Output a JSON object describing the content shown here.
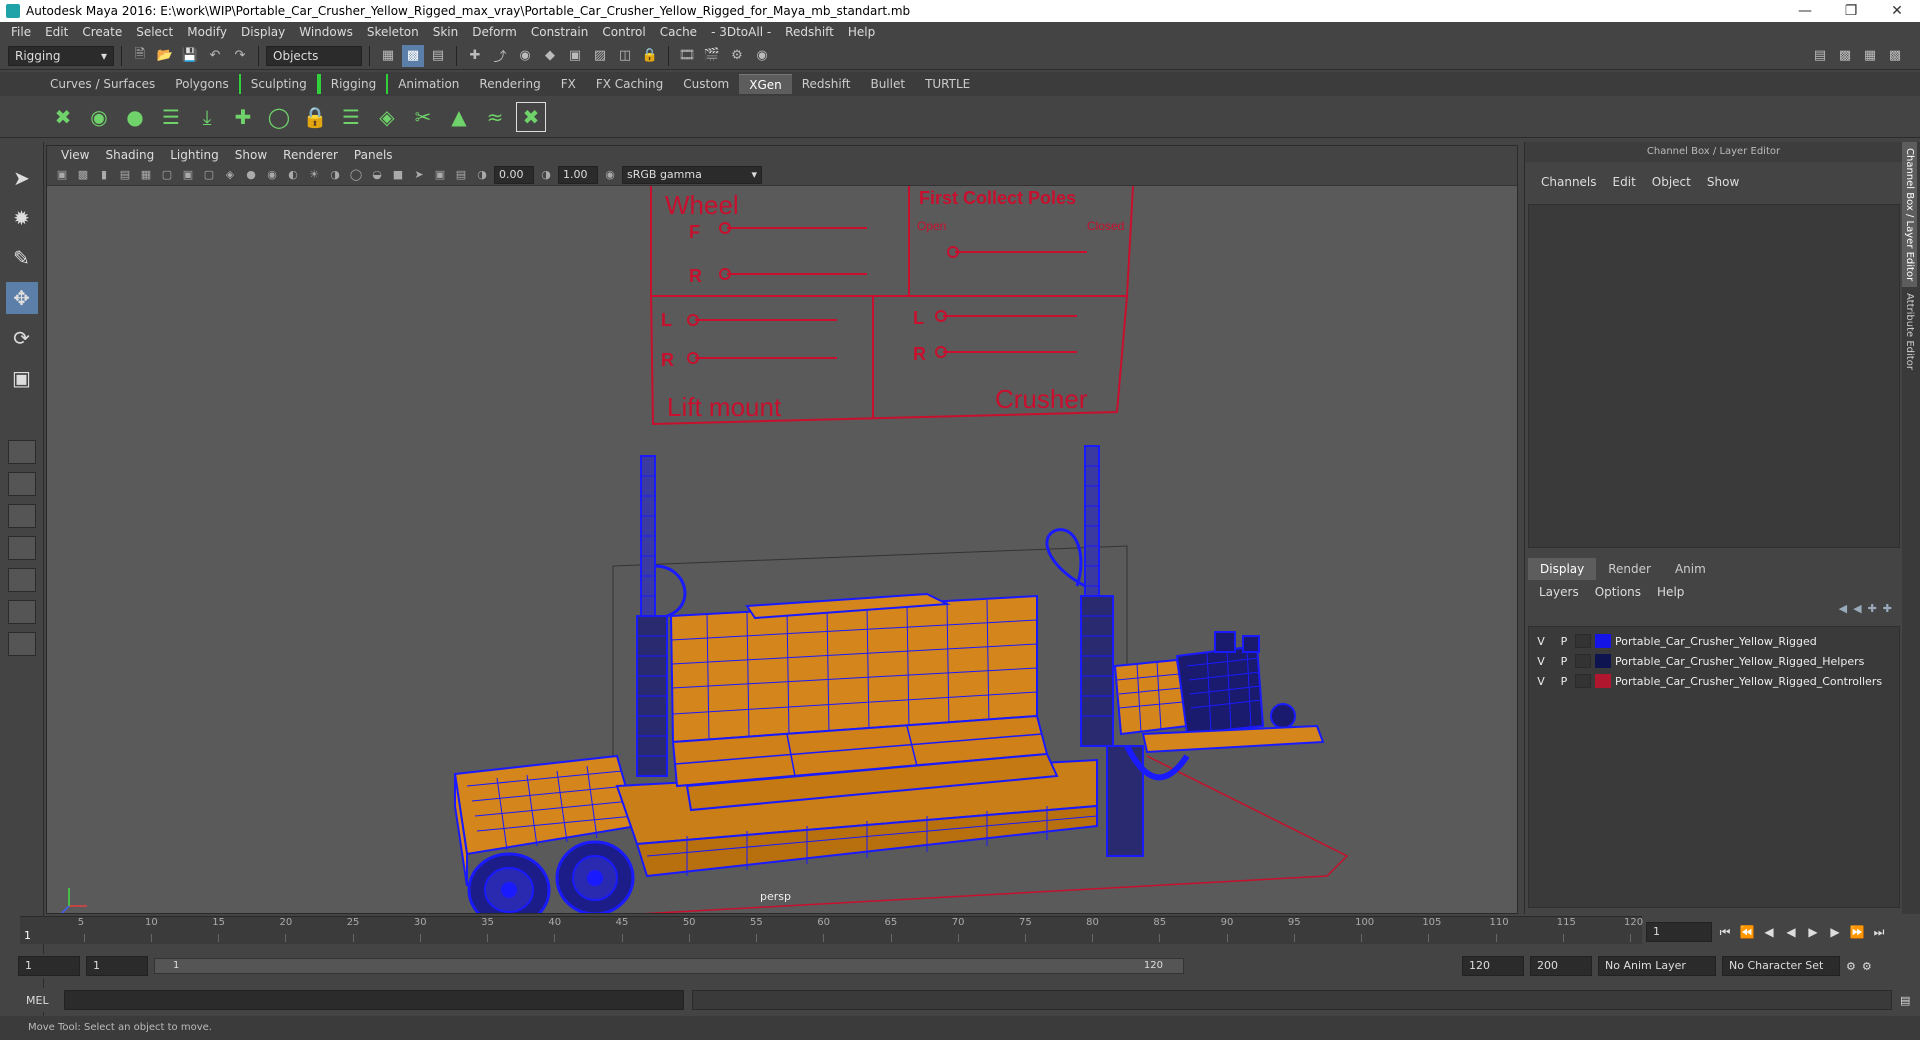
{
  "window": {
    "title": "Autodesk Maya 2016: E:\\work\\WIP\\Portable_Car_Crusher_Yellow_Rigged_max_vray\\Portable_Car_Crusher_Yellow_Rigged_for_Maya_mb_standart.mb"
  },
  "menubar": [
    "File",
    "Edit",
    "Create",
    "Select",
    "Modify",
    "Display",
    "Windows",
    "Skeleton",
    "Skin",
    "Deform",
    "Constrain",
    "Control",
    "Cache",
    "- 3DtoAll -",
    "Redshift",
    "Help"
  ],
  "statusline": {
    "mode": "Rigging",
    "selection_mode": "Objects"
  },
  "shelf_tabs": [
    "Curves / Surfaces",
    "Polygons",
    "Sculpting",
    "Rigging",
    "Animation",
    "Rendering",
    "FX",
    "FX Caching",
    "Custom",
    "XGen",
    "Redshift",
    "Bullet",
    "TURTLE"
  ],
  "shelf_tabs_active": "XGen",
  "viewport": {
    "menu": [
      "View",
      "Shading",
      "Lighting",
      "Show",
      "Renderer",
      "Panels"
    ],
    "exposure": "0.00",
    "gamma_value": "1.00",
    "color_space": "sRGB gamma",
    "camera": "persp",
    "controls": {
      "wheel_title": "Wheel",
      "wheel_f": "F",
      "wheel_r": "R",
      "poles_title": "First Collect Poles",
      "poles_open": "Open",
      "poles_closed": "Closed",
      "lift_l": "L",
      "lift_r": "R",
      "lift_title": "Lift mount",
      "crusher_l": "L",
      "crusher_r": "R",
      "crusher_title": "Crusher"
    }
  },
  "channel_box": {
    "title": "Channel Box / Layer Editor",
    "menu": [
      "Channels",
      "Edit",
      "Object",
      "Show"
    ]
  },
  "layer_editor": {
    "tabs": [
      "Display",
      "Render",
      "Anim"
    ],
    "active_tab": "Display",
    "menu": [
      "Layers",
      "Options",
      "Help"
    ],
    "layers": [
      {
        "v": "V",
        "p": "P",
        "color": "#1414e6",
        "name": "Portable_Car_Crusher_Yellow_Rigged"
      },
      {
        "v": "V",
        "p": "P",
        "color": "#0d1450",
        "name": "Portable_Car_Crusher_Yellow_Rigged_Helpers"
      },
      {
        "v": "V",
        "p": "P",
        "color": "#b0162e",
        "name": "Portable_Car_Crusher_Yellow_Rigged_Controllers"
      }
    ]
  },
  "side_tabs": [
    "Channel Box / Layer Editor",
    "Attribute Editor"
  ],
  "timeline": {
    "ticks": [
      "5",
      "10",
      "15",
      "20",
      "25",
      "30",
      "35",
      "40",
      "45",
      "50",
      "55",
      "60",
      "65",
      "70",
      "75",
      "80",
      "85",
      "90",
      "95",
      "100",
      "105",
      "110",
      "115",
      "120"
    ],
    "current_frame": "1",
    "current_frame_field": "1"
  },
  "range": {
    "start": "1",
    "playback_start": "1",
    "range_start": "1",
    "range_end": "120",
    "playback_end": "120",
    "end": "200",
    "anim_layer": "No Anim Layer",
    "character_set": "No Character Set"
  },
  "command": {
    "label": "MEL"
  },
  "help_line": "Move Tool: Select an object to move.",
  "colors": {
    "wire": "#1a1aff",
    "body": "#d4861c",
    "control": "#c8102e",
    "accent": "#5b7fa8"
  }
}
